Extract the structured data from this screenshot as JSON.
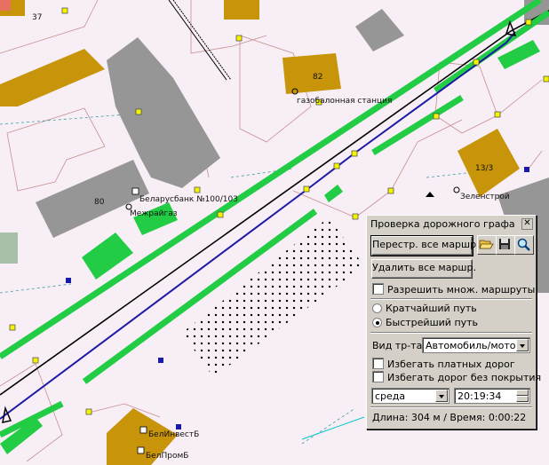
{
  "map": {
    "labels": {
      "house_37": "37",
      "house_82": "82",
      "house_80": "80",
      "house_13_3": "13/3",
      "gas_station": "газобалонная станция",
      "bank": "Беларусбанк №100/103",
      "mezhraygaz": "Межрайгаз",
      "zelenstroy": "Зеленстрой",
      "belinvest": "БелИнвестБ",
      "belprom": "БелПромБ"
    },
    "colors": {
      "background": "#f7eef6",
      "building_gold": "#c8940a",
      "building_gray": "#969696",
      "road_green": "#22cc44",
      "route_blue": "#1a1aa8",
      "rail_black": "#000000"
    }
  },
  "panel": {
    "title": "Проверка дорожного графа",
    "close_glyph": "✕",
    "rebuild_button": "Перестр. все маршр.",
    "delete_button": "Удалить все маршр.",
    "allow_multiple": "Разрешить множ. маршруты",
    "shortest_route": "Кратчайший путь",
    "fastest_route": "Быстрейший путь",
    "vehicle_label": "Вид тр-та:",
    "vehicle_value": "Автомобиль/мотоц",
    "avoid_toll": "Избегать платных дорог",
    "avoid_unpaved": "Избегать дорог без покрытия",
    "day_value": "среда",
    "time_value": "20:19:34",
    "status": "Длина: 304 м / Время: 0:00:22",
    "icons": [
      "folder-open-icon",
      "save-disk-icon",
      "magnifier-icon"
    ]
  }
}
